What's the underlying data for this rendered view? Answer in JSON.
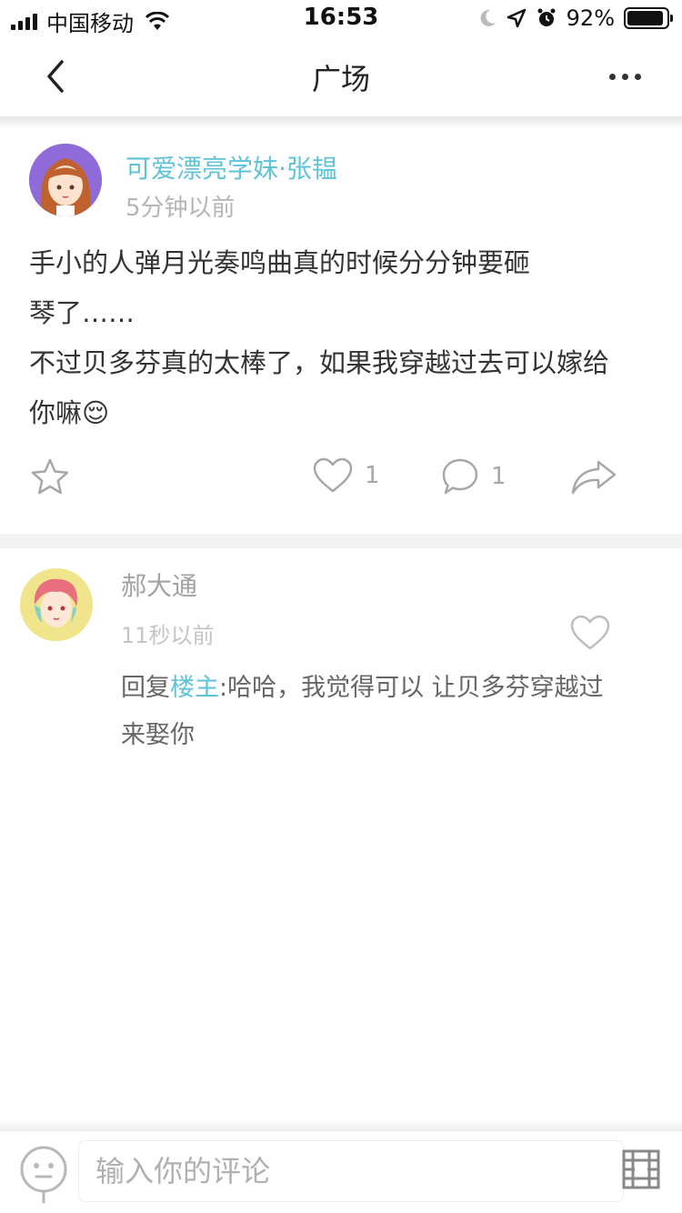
{
  "status_bar": {
    "carrier": "中国移动",
    "time": "16:53",
    "battery": "92%",
    "battery_level": 0.92
  },
  "nav": {
    "title": "广场"
  },
  "post": {
    "author": "可爱漂亮学妹·张韫",
    "time": "5分钟以前",
    "lines": [
      "手小的人弹月光奏鸣曲真的时候分分钟要砸",
      "琴了……",
      "不过贝多芬真的太棒了，如果我穿越过去可以嫁给",
      "你嘛😌"
    ],
    "like_count": "1",
    "comment_count": "1"
  },
  "comment": {
    "author": "郝大通",
    "time": "11秒以前",
    "reply_prefix": "回复",
    "reply_target": "楼主",
    "text_line1": ":哈哈，我觉得可以 让贝多芬穿越过",
    "text_line2": "来娶你"
  },
  "bottom_bar": {
    "input_placeholder": "输入你的评论"
  },
  "colors": {
    "accent": "#5ec3d8",
    "muted": "#a7a7a7",
    "text": "#333333"
  },
  "icons": {
    "back": "chevron-left-icon",
    "more": "more-dots-icon",
    "favorite": "star-icon",
    "like": "heart-icon",
    "comment": "comment-bubble-icon",
    "share": "share-arrow-icon",
    "emoji": "emoji-icon",
    "send": "send-icon"
  }
}
